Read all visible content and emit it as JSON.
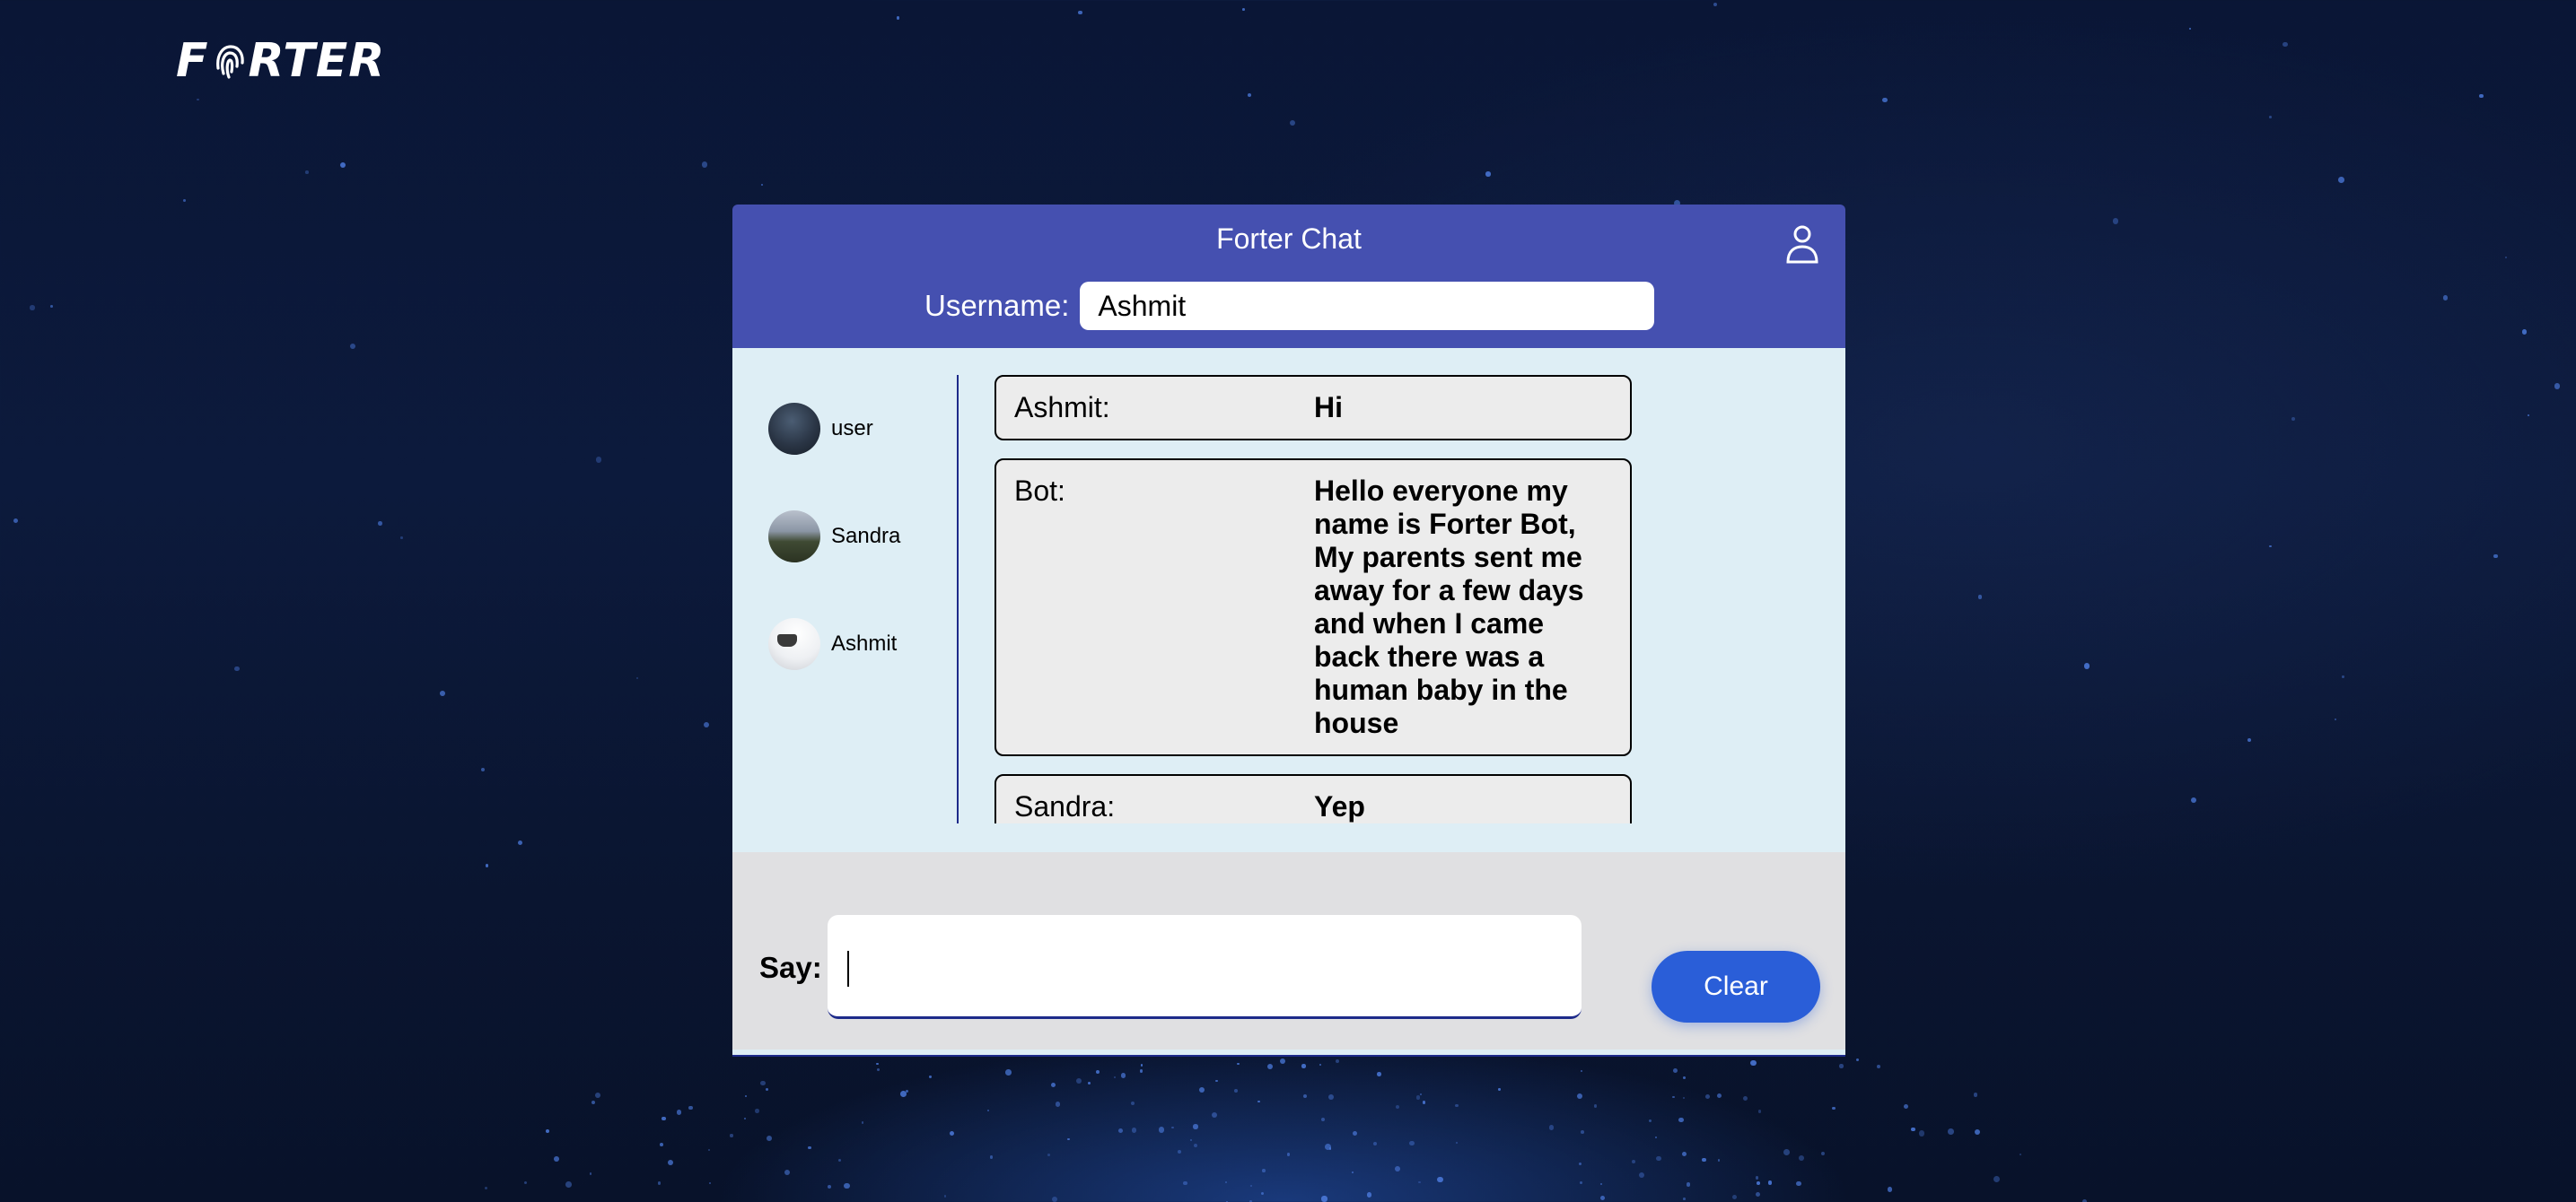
{
  "brand": {
    "logo_text": "FORTER",
    "logo_icon": "fingerprint-icon"
  },
  "chat": {
    "title": "Forter Chat",
    "user_icon": "user-profile-icon",
    "username_label": "Username:",
    "username_value": "Ashmit",
    "users": [
      {
        "name": "user",
        "avatar": "avatar-dark-sky"
      },
      {
        "name": "Sandra",
        "avatar": "avatar-landscape"
      },
      {
        "name": "Ashmit",
        "avatar": "avatar-object"
      }
    ],
    "messages": [
      {
        "author": "Ashmit:",
        "text": "Hi"
      },
      {
        "author": "Bot:",
        "text": "Hello everyone my name is Forter Bot, My parents sent me away for a few days and when I came back there was a human baby in the house"
      },
      {
        "author": "Sandra:",
        "text": "Yep"
      }
    ],
    "say_label": "Say:",
    "say_value": "",
    "clear_label": "Clear"
  },
  "colors": {
    "header": "#4550b0",
    "body": "#deeef5",
    "footer": "#e0e0e2",
    "button": "#2a5ed8",
    "page_background": "#0a1636"
  }
}
